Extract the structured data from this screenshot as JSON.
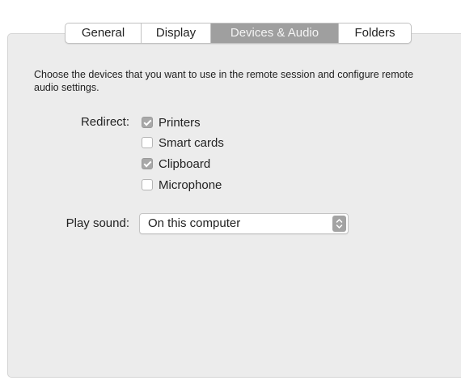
{
  "tabs": [
    {
      "label": "General",
      "active": false
    },
    {
      "label": "Display",
      "active": false
    },
    {
      "label": "Devices & Audio",
      "active": true
    },
    {
      "label": "Folders",
      "active": false
    }
  ],
  "description": "Choose the devices that you want to use in the remote session and configure remote audio settings.",
  "redirect": {
    "label": "Redirect:",
    "options": [
      {
        "label": "Printers",
        "checked": true
      },
      {
        "label": "Smart cards",
        "checked": false
      },
      {
        "label": "Clipboard",
        "checked": true
      },
      {
        "label": "Microphone",
        "checked": false
      }
    ]
  },
  "play_sound": {
    "label": "Play sound:",
    "selected": "On this computer",
    "icon": "up-down-chevron-icon"
  },
  "colors": {
    "active_tab": "#9f9f9f",
    "panel_background": "#ececec",
    "checked_box": "#a8a8a8"
  }
}
